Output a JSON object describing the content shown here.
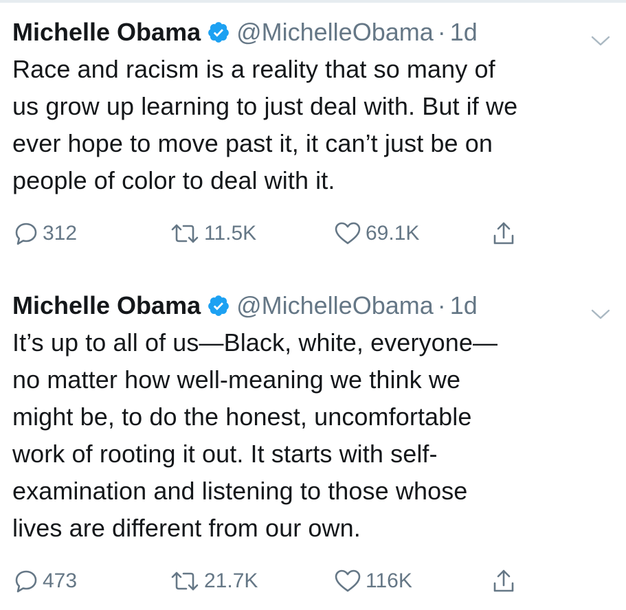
{
  "tweets": [
    {
      "author_name": "Michelle Obama",
      "handle": "@MichelleObama",
      "separator": "·",
      "time": "1d",
      "text": "Race and racism is a reality that so many of\nus grow up learning to just deal with. But if we\never hope to move past it, it can’t just be on\npeople of color to deal with it.",
      "replies": "312",
      "retweets": "11.5K",
      "likes": "69.1K"
    },
    {
      "author_name": "Michelle Obama",
      "handle": "@MichelleObama",
      "separator": "·",
      "time": "1d",
      "text": "It’s up to all of us—Black, white, everyone—\nno matter how well-meaning we think we\nmight be, to do the honest, uncomfortable\nwork of rooting it out. It starts with self-\nexamination and listening to those whose\nlives are different from our own.",
      "replies": "473",
      "retweets": "21.7K",
      "likes": "116K"
    }
  ],
  "icons": {
    "verified": "verified-badge-icon",
    "caret": "chevron-down-icon",
    "reply": "reply-bubble-icon",
    "retweet": "retweet-icon",
    "like": "heart-icon",
    "share": "share-icon"
  },
  "colors": {
    "text": "#14171a",
    "secondary": "#657786",
    "verified": "#1da1f2",
    "divider": "#e6ecf0"
  }
}
